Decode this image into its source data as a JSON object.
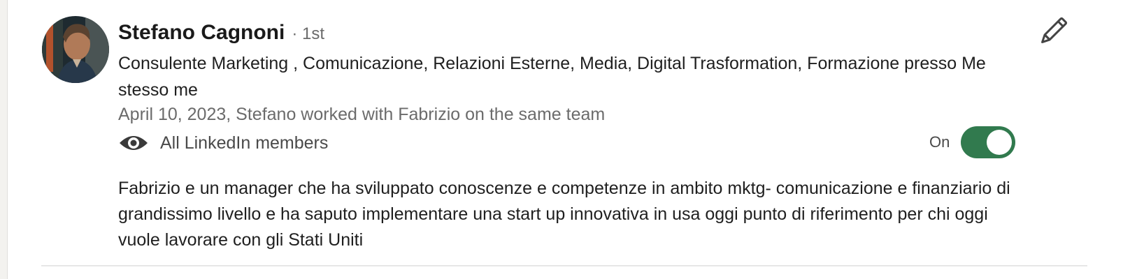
{
  "recommendation": {
    "name": "Stefano Cagnoni",
    "degree": "· 1st",
    "headline": "Consulente Marketing , Comunicazione, Relazioni Esterne, Media, Digital Trasformation, Formazione presso Me stesso me",
    "relation": "April 10, 2023, Stefano worked with Fabrizio on the same team",
    "visibility": {
      "icon": "eye-icon",
      "label": "All LinkedIn members"
    },
    "toggle": {
      "label": "On",
      "state": "on",
      "color": "#317a4e"
    },
    "edit_icon": "pencil-icon",
    "text": "Fabrizio e un manager che ha sviluppato conoscenze e competenze in ambito mktg- comunicazione e finanziario di grandissimo livello e ha saputo implementare una start up innovativa in usa oggi punto di riferimento per chi oggi vuole lavorare con gli Stati Uniti"
  }
}
